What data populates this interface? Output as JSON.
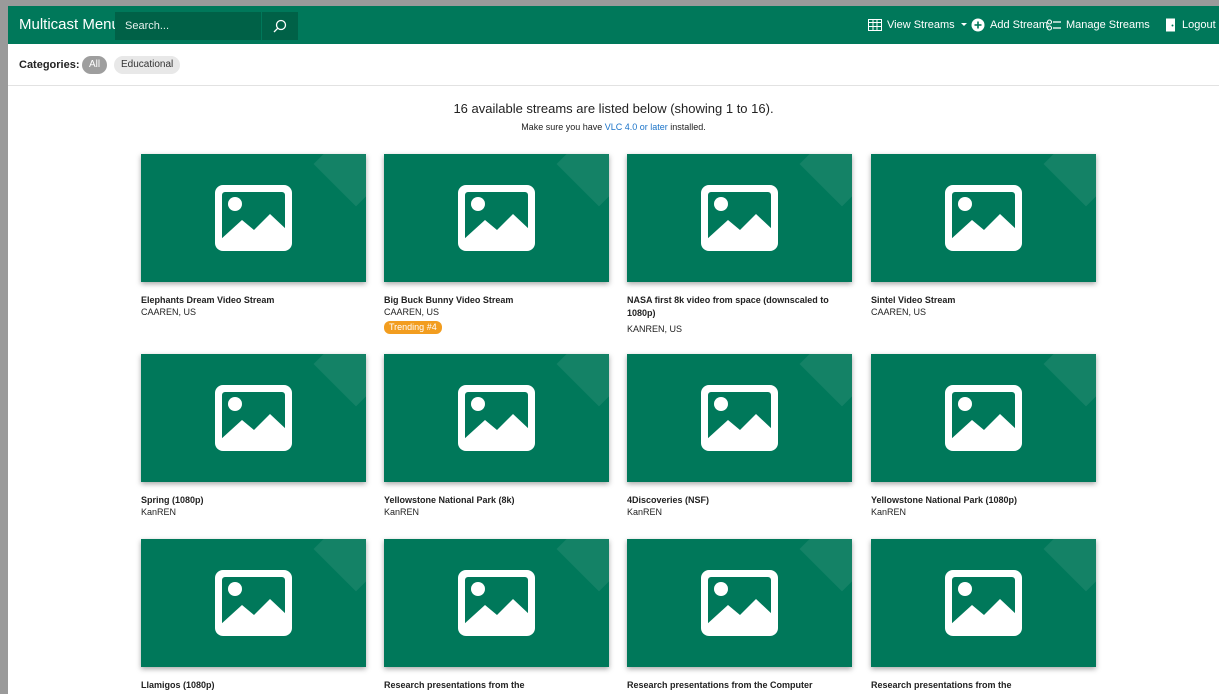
{
  "navbar": {
    "brand": "Multicast Menu",
    "search_placeholder": "Search...",
    "view_streams": "View Streams",
    "add_stream": "Add Stream",
    "manage_streams": "Manage Streams",
    "logout": "Logout"
  },
  "categories": {
    "label": "Categories:",
    "items": [
      "All",
      "Educational"
    ]
  },
  "summary": {
    "headline": "16 available streams are listed below (showing 1 to 16).",
    "note_prefix": "Make sure you have ",
    "note_link": "VLC 4.0 or later",
    "note_suffix": " installed."
  },
  "streams": [
    {
      "title": "Elephants Dream Video Stream",
      "source": "CAAREN, US"
    },
    {
      "title": "Big Buck Bunny Video Stream",
      "source": "CAAREN, US",
      "badge": "Trending #4"
    },
    {
      "title": "NASA first 8k video from space (downscaled to 1080p)",
      "source": "KANREN, US"
    },
    {
      "title": "Sintel Video Stream",
      "source": "CAAREN, US"
    },
    {
      "title": "Spring (1080p)",
      "source": "KanREN"
    },
    {
      "title": "Yellowstone National Park (8k)",
      "source": "KanREN"
    },
    {
      "title": "4Discoveries (NSF)",
      "source": "KanREN"
    },
    {
      "title": "Yellowstone National Park (1080p)",
      "source": "KanREN"
    },
    {
      "title": "Llamigos (1080p)",
      "source": ""
    },
    {
      "title": "Research presentations from the",
      "source": ""
    },
    {
      "title": "Research presentations from the Computer",
      "source": ""
    },
    {
      "title": "Research presentations from the",
      "source": ""
    }
  ],
  "colors": {
    "brand_green": "#00785a",
    "badge_orange": "#f29d1f",
    "link_blue": "#1a73c8"
  },
  "icons": {
    "thumbnail": "image-placeholder-icon",
    "search": "search-icon",
    "view_streams": "grid-table-icon",
    "add_stream": "plus-circle-icon",
    "manage_streams": "list-settings-icon",
    "logout": "door-exit-icon"
  }
}
